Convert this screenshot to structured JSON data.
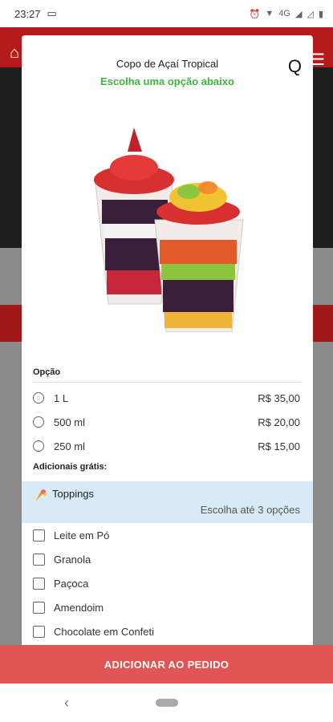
{
  "status": {
    "time": "23:27",
    "network": "4G"
  },
  "modal": {
    "title": "Copo de Açaí Tropical",
    "subtitle": "Escolha uma opção abaixo",
    "close_label": "Q"
  },
  "options_section": {
    "label": "Opção",
    "items": [
      {
        "label": "1 L",
        "price": "R$ 35,00"
      },
      {
        "label": "500 ml",
        "price": "R$ 20,00"
      },
      {
        "label": "250 ml",
        "price": "R$ 15,00"
      }
    ]
  },
  "extras_section": {
    "label": "Adicionais grátis:",
    "group": {
      "label": "Toppings",
      "hint": "Escolha até 3 opções"
    },
    "items": [
      "Leite em Pó",
      "Granola",
      "Paçoca",
      "Amendoim",
      "Chocolate em Confeti"
    ]
  },
  "action": {
    "add_label": "ADICIONAR AO PEDIDO"
  },
  "colors": {
    "accent_green": "#3db53d",
    "button_red": "#e15555",
    "highlight_blue": "#d8eaf5"
  }
}
